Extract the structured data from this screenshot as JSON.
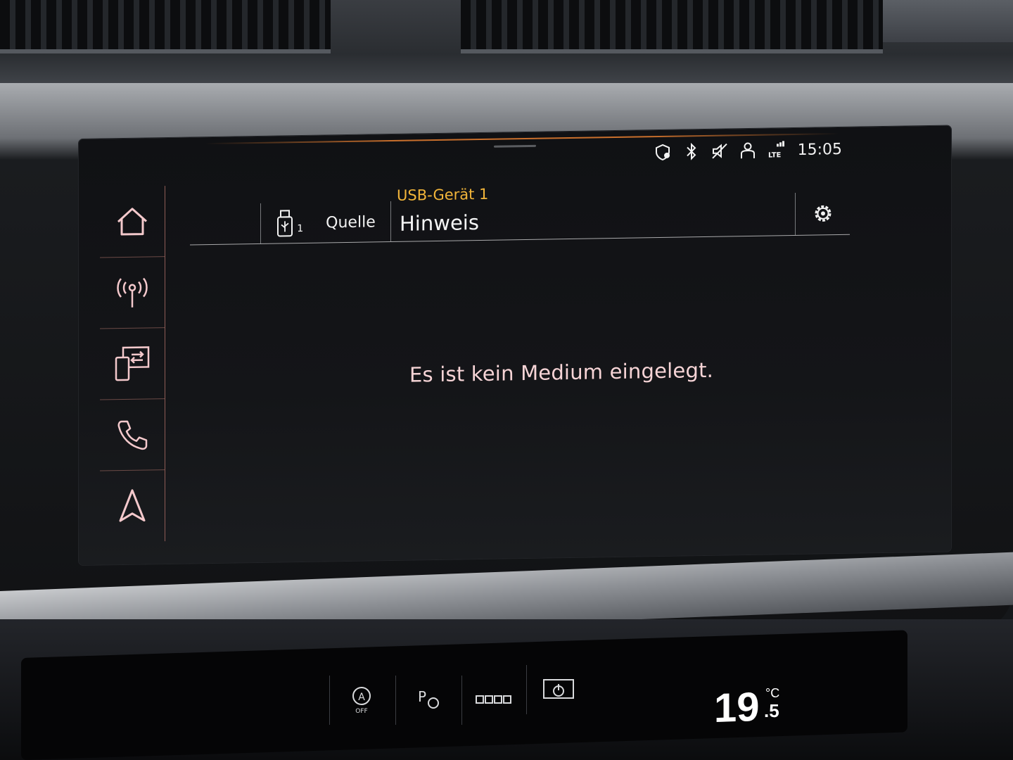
{
  "status_bar": {
    "time": "15:05",
    "icons": [
      "location-shield-icon",
      "bluetooth-icon",
      "mute-icon",
      "user-profile-icon",
      "lte-signal-icon"
    ]
  },
  "sidebar": {
    "items": [
      {
        "name": "home-icon"
      },
      {
        "name": "radio-icon"
      },
      {
        "name": "media-icon"
      },
      {
        "name": "phone-icon"
      },
      {
        "name": "navigation-icon"
      }
    ]
  },
  "header": {
    "source_label": "Quelle",
    "source_sub": "1",
    "device_label": "USB-Gerät 1",
    "title": "Hinweis"
  },
  "main": {
    "message": "Es ist kein Medium eingelegt."
  },
  "climate": {
    "temp_whole": "19",
    "temp_fraction": ".5",
    "unit": "°C"
  },
  "lower_panel": {
    "buttons": [
      "A OFF",
      "P",
      "oooo",
      "power"
    ]
  },
  "colors": {
    "accent_orange": "#f2b53a",
    "icon_pink": "#f4c9cc",
    "message_text": "#f6d4d6"
  }
}
